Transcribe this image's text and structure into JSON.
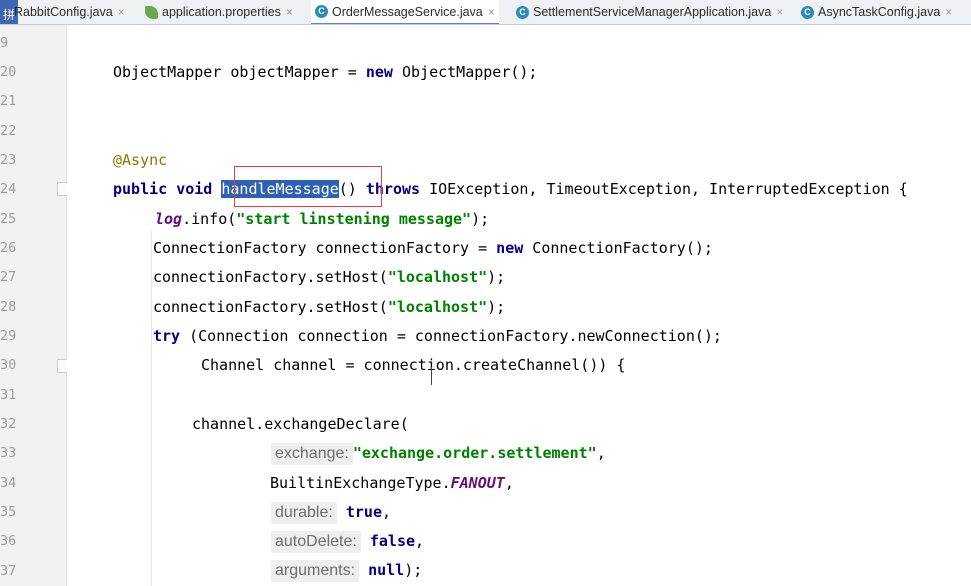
{
  "tabs": [
    {
      "label": "RabbitConfig.java",
      "icon": "class-icon",
      "active": false
    },
    {
      "label": "application.properties",
      "icon": "spring-leaf-icon",
      "active": false
    },
    {
      "label": "OrderMessageService.java",
      "icon": "class-icon",
      "active": true
    },
    {
      "label": "SettlementServiceManagerApplication.java",
      "icon": "class-icon",
      "active": false
    },
    {
      "label": "AsyncTaskConfig.java",
      "icon": "class-icon",
      "active": false
    }
  ],
  "close_glyph": "×",
  "line_numbers": [
    "9",
    "20",
    "21",
    "22",
    "23",
    "24",
    "25",
    "26",
    "27",
    "28",
    "29",
    "30",
    "31",
    "32",
    "33",
    "34",
    "35",
    "36",
    "37"
  ],
  "code": {
    "l20": {
      "type": "ObjectMapper ",
      "var": "objectMapper = ",
      "kw": "new",
      "rest": " ObjectMapper();"
    },
    "l23": {
      "annotation": "@Async"
    },
    "l24": {
      "kw1": "public",
      "kw2": "void",
      "method": "handleMessage",
      "parens": "()",
      "kw3": "throws",
      "rest": " IOException, TimeoutException, InterruptedException {"
    },
    "l25": {
      "log": "log",
      "call": ".info(",
      "str": "\"start linstening message\"",
      "end": ");"
    },
    "l26": {
      "text": "ConnectionFactory connectionFactory = ",
      "kw": "new",
      "rest": " ConnectionFactory();"
    },
    "l27": {
      "call": "connectionFactory.setHost(",
      "str": "\"localhost\"",
      "end": ");"
    },
    "l28": {
      "call": "connectionFactory.setHost(",
      "str": "\"localhost\"",
      "end": ");"
    },
    "l29": {
      "kw": "try",
      "rest": " (Connection connection = connectionFactory.newConnection();"
    },
    "l30": {
      "text": "Channel channel = connection.createChannel()) {"
    },
    "l32": {
      "text": "channel.exchangeDeclare("
    },
    "l33": {
      "hint": "exchange:",
      "str": "\"exchange.order.settlement\"",
      "end": ","
    },
    "l34": {
      "text": "BuiltinExchangeType.",
      "const": "FANOUT",
      "end": ","
    },
    "l35": {
      "hint": "durable:",
      "kw": "true",
      "end": ","
    },
    "l36": {
      "hint": "autoDelete:",
      "kw": "false",
      "end": ","
    },
    "l37": {
      "hint": "arguments:",
      "kw": "null",
      "end": ");"
    }
  },
  "colors": {
    "keyword": "#000080",
    "string": "#008000",
    "annotation": "#808000",
    "selection": "#2e61b5",
    "highlight_box": "#e04040"
  }
}
